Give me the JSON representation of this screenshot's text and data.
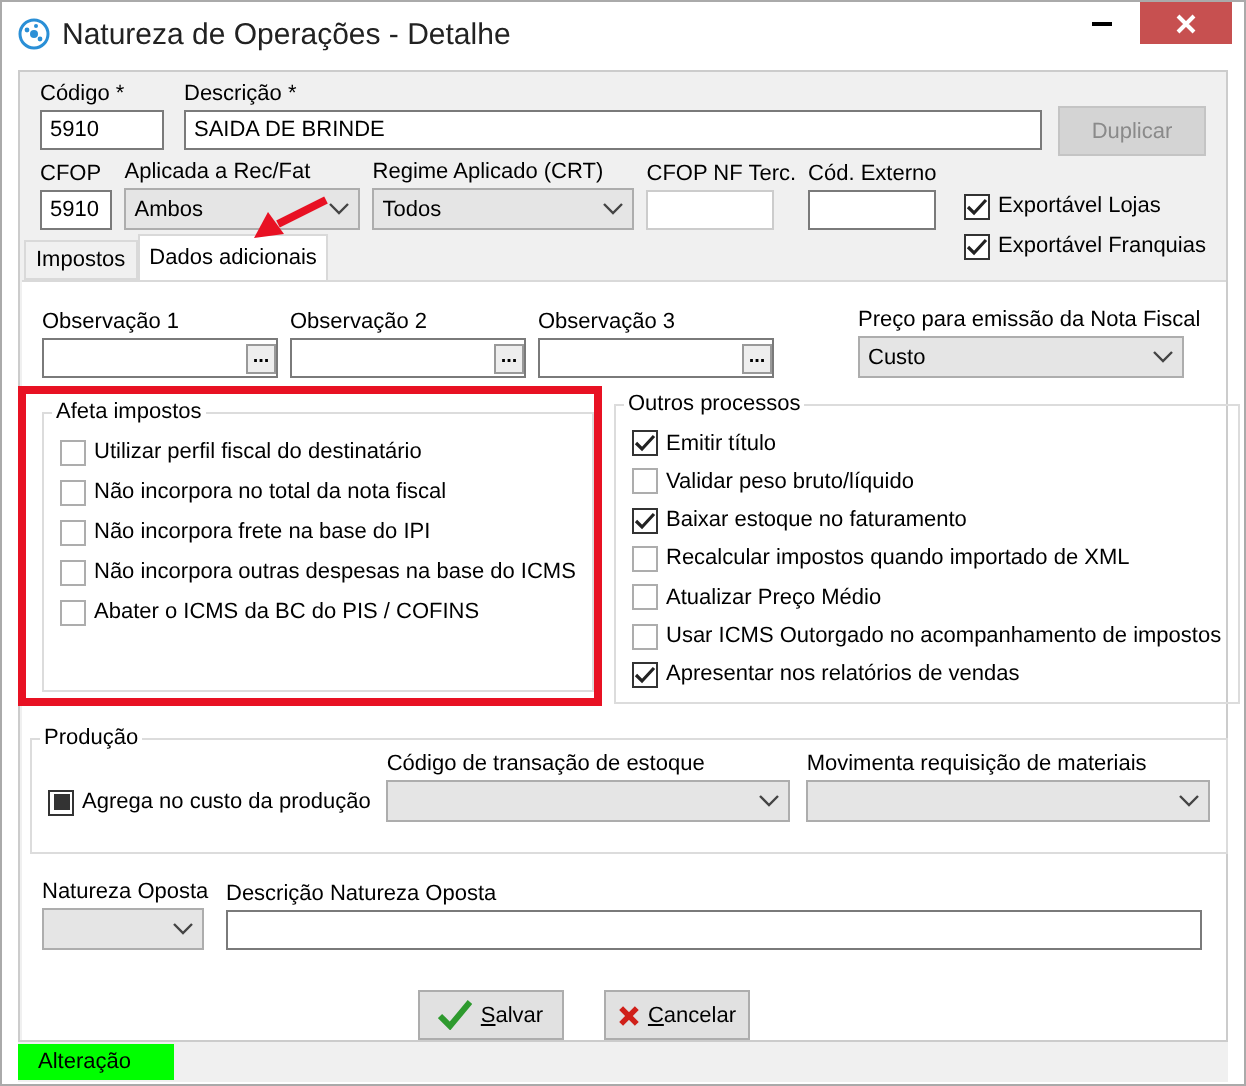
{
  "window": {
    "title": "Natureza de Operações - Detalhe"
  },
  "header": {
    "codigo": {
      "label": "Código *",
      "value": "5910"
    },
    "descricao": {
      "label": "Descrição *",
      "value": "SAIDA DE BRINDE"
    },
    "duplicar": {
      "label": "Duplicar",
      "disabled": true
    },
    "cfop": {
      "label": "CFOP",
      "value": "5910"
    },
    "aplicada": {
      "label": "Aplicada a Rec/Fat",
      "value": "Ambos"
    },
    "regime": {
      "label": "Regime Aplicado (CRT)",
      "value": "Todos"
    },
    "cfop_nf_terc": {
      "label": "CFOP NF Terc."
    },
    "cod_externo": {
      "label": "Cód. Externo"
    },
    "export_options": [
      {
        "label": "Exportável Lojas",
        "checked": true
      },
      {
        "label": "Exportável Franquias",
        "checked": true
      }
    ]
  },
  "tabs": [
    {
      "label": "Impostos",
      "selected": false
    },
    {
      "label": "Dados adicionais",
      "selected": true
    }
  ],
  "observations": [
    {
      "label": "Observação 1",
      "button": "..."
    },
    {
      "label": "Observação 2",
      "button": "..."
    },
    {
      "label": "Observação 3",
      "button": "..."
    }
  ],
  "preco": {
    "label": "Preço para emissão da Nota Fiscal",
    "value": "Custo"
  },
  "afeta_impostos": {
    "title": "Afeta impostos",
    "items": [
      {
        "label": "Utilizar perfil fiscal do destinatário",
        "checked": false
      },
      {
        "label": "Não incorpora no total da nota fiscal",
        "checked": false
      },
      {
        "label": "Não incorpora frete na base do IPI",
        "checked": false
      },
      {
        "label": "Não incorpora outras despesas na base do ICMS",
        "checked": false
      },
      {
        "label": "Abater o ICMS da BC do PIS / COFINS",
        "checked": false
      }
    ]
  },
  "outros_processos": {
    "title": "Outros processos",
    "items": [
      {
        "label": "Emitir título",
        "checked": true
      },
      {
        "label": "Validar peso bruto/líquido",
        "checked": false
      },
      {
        "label": "Baixar estoque no faturamento",
        "checked": true
      },
      {
        "label": "Recalcular impostos quando importado de XML",
        "checked": false
      },
      {
        "label": "Atualizar Preço Médio",
        "checked": false
      },
      {
        "label": "Usar ICMS Outorgado no acompanhamento de impostos",
        "checked": false
      },
      {
        "label": "Apresentar nos relatórios de vendas",
        "checked": true
      }
    ]
  },
  "producao": {
    "title": "Produção",
    "agrega": {
      "label": "Agrega no custo da produção",
      "indeterminate": true
    },
    "codigo_transacao": {
      "label": "Código de transação de estoque"
    },
    "movimenta": {
      "label": "Movimenta requisição de materiais"
    }
  },
  "natureza_oposta": {
    "label": "Natureza Oposta"
  },
  "descricao_natureza_oposta": {
    "label": "Descrição Natureza Oposta"
  },
  "buttons": [
    {
      "label": "Salvar",
      "kind": "save"
    },
    {
      "label": "Cancelar",
      "kind": "cancel"
    }
  ],
  "status_bar": {
    "text": "Alteração"
  }
}
